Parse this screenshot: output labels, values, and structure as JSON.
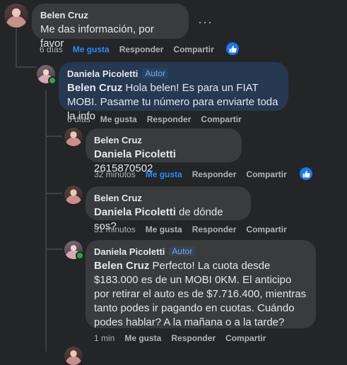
{
  "labels": {
    "like": "Me gusta",
    "reply": "Responder",
    "share": "Compartir",
    "author_badge": "Autor",
    "more": "···"
  },
  "comments": [
    {
      "author": "Belen Cruz",
      "text": "Me das información, por favor",
      "time": "6 días",
      "liked": true
    },
    {
      "author": "Daniela Picoletti",
      "is_author": true,
      "mention": "Belen Cruz",
      "text": "Hola belen! Es para un FIAT MOBI. Pasame tu número para enviarte toda la info",
      "time": "6 días",
      "liked": false
    },
    {
      "author": "Belen Cruz",
      "mention": "Daniela Picoletti",
      "text": "2615870502",
      "time": "32 minutos",
      "liked": true
    },
    {
      "author": "Belen Cruz",
      "mention": "Daniela Picoletti",
      "text": "de dónde sos?",
      "time": "31 minutos",
      "liked": false
    },
    {
      "author": "Daniela Picoletti",
      "is_author": true,
      "mention": "Belen Cruz",
      "text": "Perfecto! La cuota desde $183.000 es de un MOBI 0KM. El anticipo por retirar el auto es de $7.716.400, mientras tanto podes ir pagando en cuotas. Cuándo podes hablar? A la mañana o a la tarde?",
      "time": "1 min",
      "liked": false
    }
  ],
  "colors": {
    "background": "#242526",
    "bubble": "#3a3b3c",
    "bubble_highlight": "#263951",
    "link_blue": "#2d88ff",
    "muted": "#b0b3b8"
  }
}
